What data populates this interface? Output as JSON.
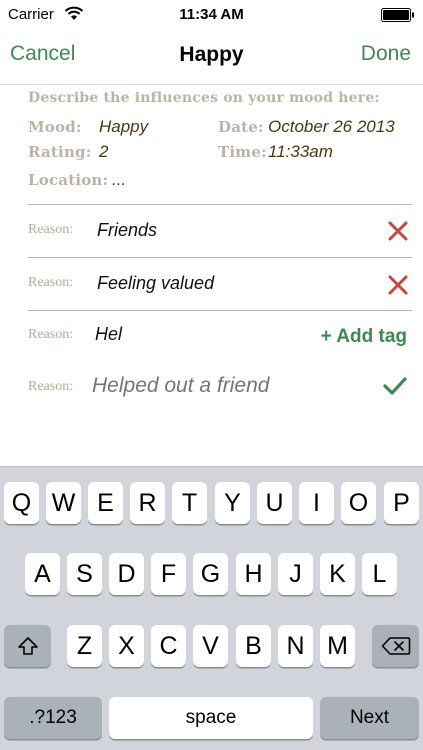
{
  "status": {
    "carrier": "Carrier",
    "time": "11:34 AM"
  },
  "nav": {
    "cancel": "Cancel",
    "title": "Happy",
    "done": "Done"
  },
  "form": {
    "prompt": "Describe the influences on your mood here:",
    "mood_label": "Mood:",
    "mood_value": "Happy",
    "date_label": "Date:",
    "date_value": "October 26 2013",
    "rating_label": "Rating:",
    "rating_value": "2",
    "time_label": "Time:",
    "time_value": "11:33am",
    "location_label": "Location:",
    "location_value": "..."
  },
  "reasons": [
    {
      "label": "Reason:",
      "value": "Friends",
      "action": "remove-icon"
    },
    {
      "label": "Reason:",
      "value": "Feeling valued",
      "action": "remove-icon"
    },
    {
      "label": "Reason:",
      "value": "Hel",
      "action_label": "+ Add tag"
    }
  ],
  "new_reason": {
    "label": "Reason:",
    "placeholder": "Helped out a friend"
  },
  "keyboard": {
    "row1": [
      "Q",
      "W",
      "E",
      "R",
      "T",
      "Y",
      "U",
      "I",
      "O",
      "P"
    ],
    "row2": [
      "A",
      "S",
      "D",
      "F",
      "G",
      "H",
      "J",
      "K",
      "L"
    ],
    "row3": [
      "Z",
      "X",
      "C",
      "V",
      "B",
      "N",
      "M"
    ],
    "numbers_key": ".?123",
    "space_key": "space",
    "next_key": "Next"
  },
  "colors": {
    "accent": "#3d8a4f",
    "label": "#bdb2a5",
    "value": "#4a3712",
    "remove": "#c9463d",
    "keyboard": "#d1d5db"
  }
}
